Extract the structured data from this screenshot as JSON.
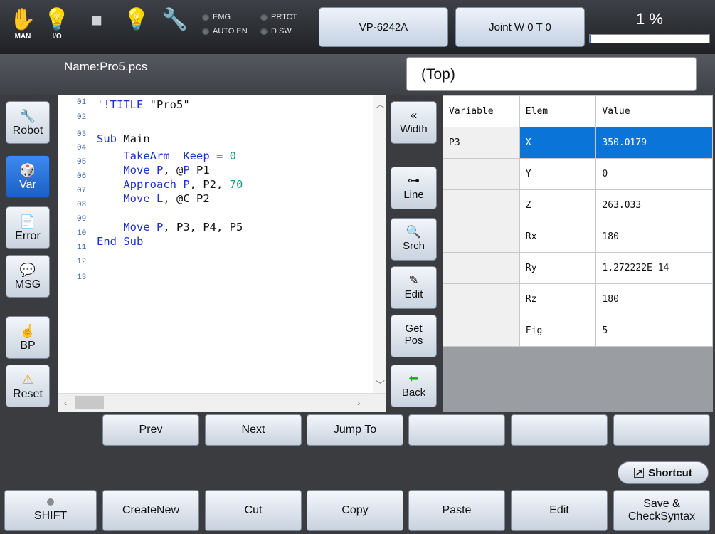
{
  "topbar": {
    "icons": [
      {
        "name": "man-hand-icon",
        "caption": "MAN",
        "glyph": "✋"
      },
      {
        "name": "io-bulb-icon",
        "caption": "I/O",
        "glyph": "💡"
      },
      {
        "name": "stop-square-icon",
        "caption": "",
        "glyph": "■"
      },
      {
        "name": "lamp-bulb-icon",
        "caption": "",
        "glyph": "💡"
      },
      {
        "name": "wrench-icon",
        "caption": "",
        "glyph": "🔧"
      }
    ],
    "lamps": {
      "emg": "EMG",
      "prtct": "PRTCT",
      "auto_en": "AUTO EN",
      "dsw": "D SW"
    },
    "robot_model": "VP-6242A",
    "joint_mode": "Joint W 0 T 0",
    "speed_label": "1 %",
    "speed_fraction": 0.01
  },
  "file": {
    "name": "Name:Pro5.pcs",
    "location": "(Top)"
  },
  "side_buttons": [
    {
      "label": "Robot",
      "icon": "robot-arm-icon",
      "glyph": "🔧",
      "active": false
    },
    {
      "label": "Var",
      "icon": "dice-icon",
      "glyph": "🎲",
      "active": true
    },
    {
      "label": "Error",
      "icon": "error-doc-icon",
      "glyph": "📄",
      "active": false
    },
    {
      "label": "MSG",
      "icon": "speech-bubble-icon",
      "glyph": "💬",
      "active": false
    },
    {
      "label": "BP",
      "icon": "hand-pointer-icon",
      "glyph": "☝",
      "active": false
    },
    {
      "label": "Reset",
      "icon": "warning-icon",
      "glyph": "⚠",
      "active": false
    }
  ],
  "editor": {
    "line_numbers": [
      "01",
      "02",
      "03",
      "04",
      "05",
      "06",
      "07",
      "08",
      "09",
      "10",
      "11",
      "12",
      "13"
    ],
    "lines": [
      "'!TITLE \"Pro5\"",
      "",
      "Sub Main",
      "    TakeArm  Keep = 0",
      "    Move P, @P P1",
      "    Approach P, P2, 70",
      "    Move L, @C P2",
      "",
      "    Move P, P3, P4, P5",
      "End Sub",
      "",
      "",
      ""
    ]
  },
  "mid_buttons": [
    {
      "label": "Width",
      "icon": "double-left-arrow-icon",
      "glyph": "«"
    },
    {
      "label": "Line",
      "icon": "binoculars-icon",
      "glyph": "⊶"
    },
    {
      "label": "Srch",
      "icon": "magnifier-icon",
      "glyph": "🔍"
    },
    {
      "label": "Edit",
      "icon": "pencil-icon",
      "glyph": "✎"
    },
    {
      "label": "Get\nPos",
      "icon": "",
      "glyph": ""
    },
    {
      "label": "Back",
      "icon": "green-back-arrow-icon",
      "glyph": "⬅"
    }
  ],
  "var_table": {
    "headers": [
      "Variable",
      "Elem",
      "Value"
    ],
    "rows": [
      [
        "P3",
        "X",
        "350.0179"
      ],
      [
        "",
        "Y",
        "0"
      ],
      [
        "",
        "Z",
        "263.033"
      ],
      [
        "",
        "Rx",
        "180"
      ],
      [
        "",
        "Ry",
        "1.272222E-14"
      ],
      [
        "",
        "Rz",
        "180"
      ],
      [
        "",
        "Fig",
        "5"
      ]
    ],
    "selected_row": 0
  },
  "nav_row": [
    "Prev",
    "Next",
    "Jump To",
    "",
    "",
    ""
  ],
  "shortcut_label": "Shortcut",
  "func_row": [
    "SHIFT",
    "CreateNew",
    "Cut",
    "Copy",
    "Paste",
    "Edit",
    "Save &\nCheckSyntax"
  ]
}
